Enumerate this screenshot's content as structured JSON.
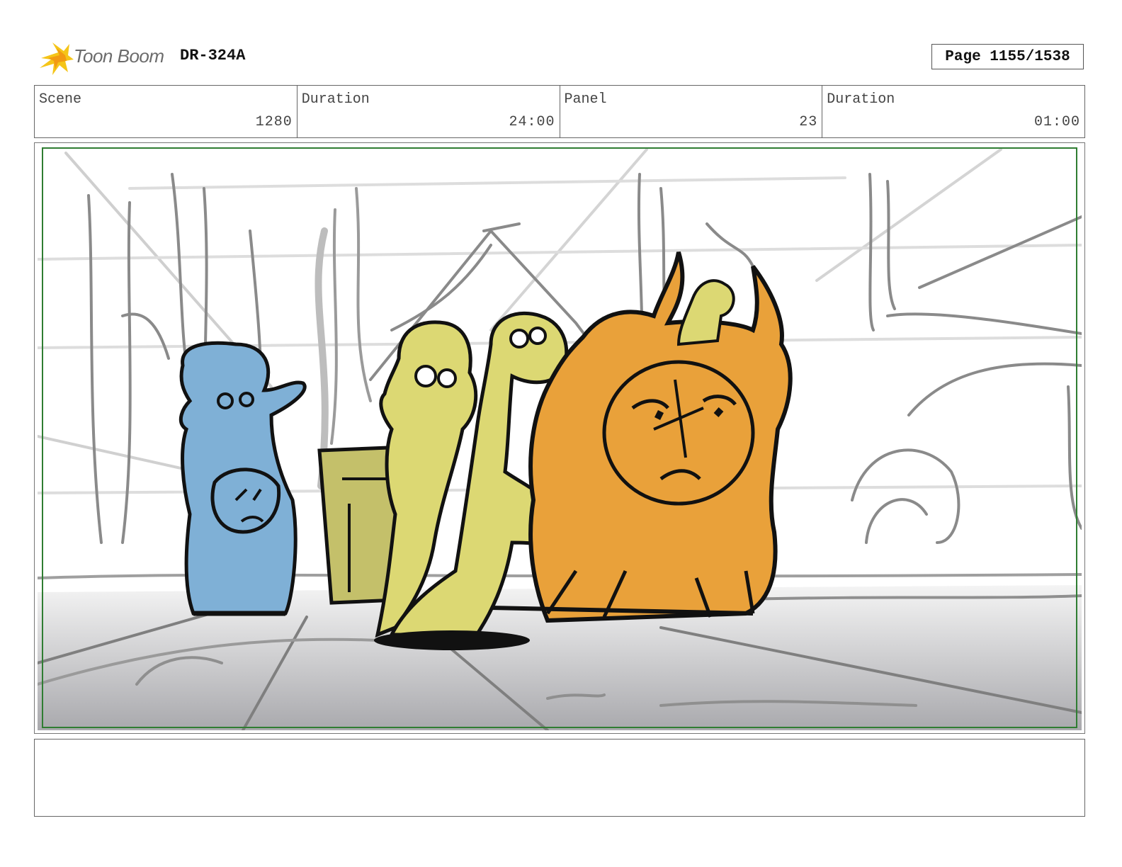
{
  "header": {
    "logo_text": "Toon Boom",
    "project_code": "DR-324A",
    "page_label": "Page 1155/1538"
  },
  "info": {
    "scene_label": "Scene",
    "scene_value": "1280",
    "scene_duration_label": "Duration",
    "scene_duration_value": "24:00",
    "panel_label": "Panel",
    "panel_value": "23",
    "panel_duration_label": "Duration",
    "panel_duration_value": "01:00"
  },
  "colors": {
    "safe_frame": "#2f7d32",
    "blue_character": "#7fb0d6",
    "yellow_character": "#dcd873",
    "orange_character": "#e9a13a",
    "logo_accent": "#f5c518"
  },
  "notes": {
    "text": ""
  }
}
